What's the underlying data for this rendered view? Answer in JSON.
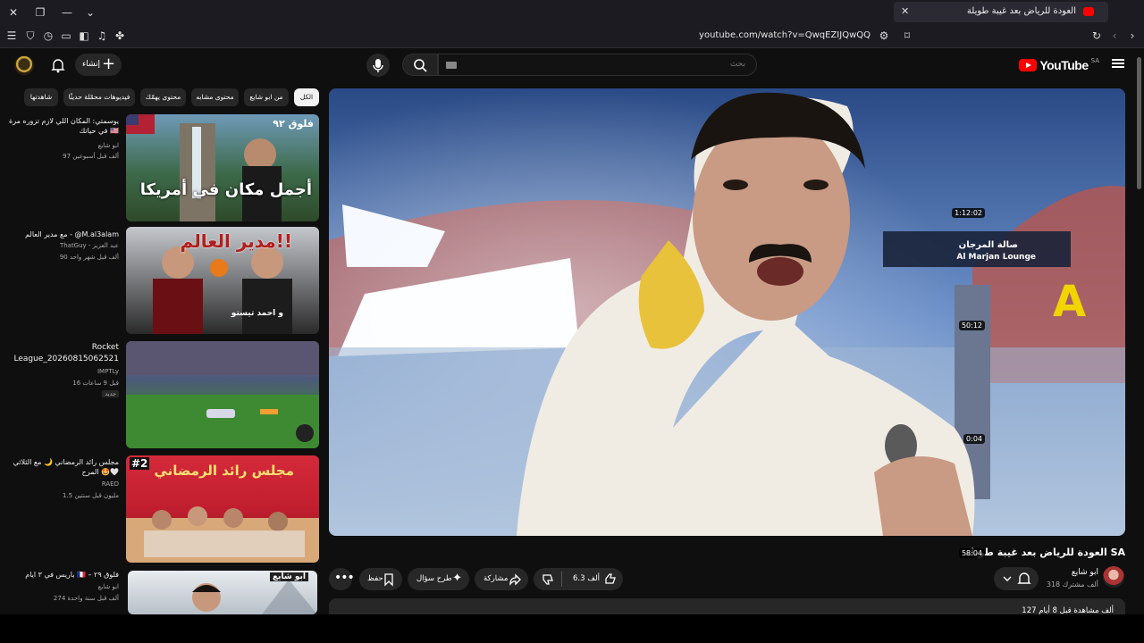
{
  "browser": {
    "tab_title": "العودة للرياض بعد غيبة طويلة",
    "new_tab_glyph": "+",
    "close_glyph": "✕",
    "url": "youtube.com/watch?v=QwqEZIJQwQQ"
  },
  "header": {
    "logo_text": "YouTube",
    "logo_region": "SA",
    "search_placeholder": "بحث",
    "create_label": "إنشاء"
  },
  "video": {
    "title": "العودة للرياض بعد غيبة طويلة SA",
    "channel_name": "ابو شايع",
    "subscribers": "318 ألف مشترك",
    "likes": "6.3 ألف",
    "share_label": "مشاركة",
    "ask_label": "طرح سؤال",
    "save_label": "حفظ",
    "views_line": "127 ألف مشاهدة قبل 8 أيام",
    "overlay_sign1": "صالة المرجان",
    "overlay_sign2": "Al Marjan Lounge",
    "overlay_letter": "A"
  },
  "chips": [
    {
      "label": "الكل",
      "active": true
    },
    {
      "label": "من ابو شايع"
    },
    {
      "label": "محتوى مشابه"
    },
    {
      "label": "محتوى يهمّك"
    },
    {
      "label": "فيديوهات محمّلة حديثًا"
    },
    {
      "label": "شاهدتها"
    }
  ],
  "sidebar": [
    {
      "title": "يوسمتي: المكان اللي لازم تزوره مرة في حياتك 🇺🇸",
      "channel": "ابو شايع",
      "meta": "97 ألف  قبل أسبوعين",
      "duration": "1:12:02",
      "thumb_text": "أجمل مكان في أمريكا",
      "thumb_badge": "فلوق ٩٢"
    },
    {
      "title": "مع مدير العالم - @M.al3alam",
      "channel": "ThatGuy - عبد العزيز",
      "meta": "90 ألف  قبل شهر واحد",
      "duration": "50:12",
      "thumb_text": "مدير العالم!!",
      "thumb_sub": "و احمد تيستو"
    },
    {
      "title": "Rocket League_20260815062521",
      "channel": "IMPTLy",
      "meta": "16  قبل 9 ساعات",
      "duration": "0:04",
      "badge": "جديد"
    },
    {
      "title": "مجلس رائد الرمضاني 🌙 مع الثلاثي المرح 🤩🤍",
      "channel": "RAED",
      "meta": "1.5 مليون  قبل سنتين",
      "duration": "58:04",
      "thumb_text": "مجلس رائد الرمضاني",
      "thumb_badge": "#2"
    },
    {
      "title": "باريس في ٣ ايام 🇫🇷 – فلوق ٢٩",
      "channel": "ابو شايع",
      "meta": "274 ألف  قبل سنة واحدة",
      "duration": "",
      "thumb_text": "ابو شايع"
    }
  ]
}
